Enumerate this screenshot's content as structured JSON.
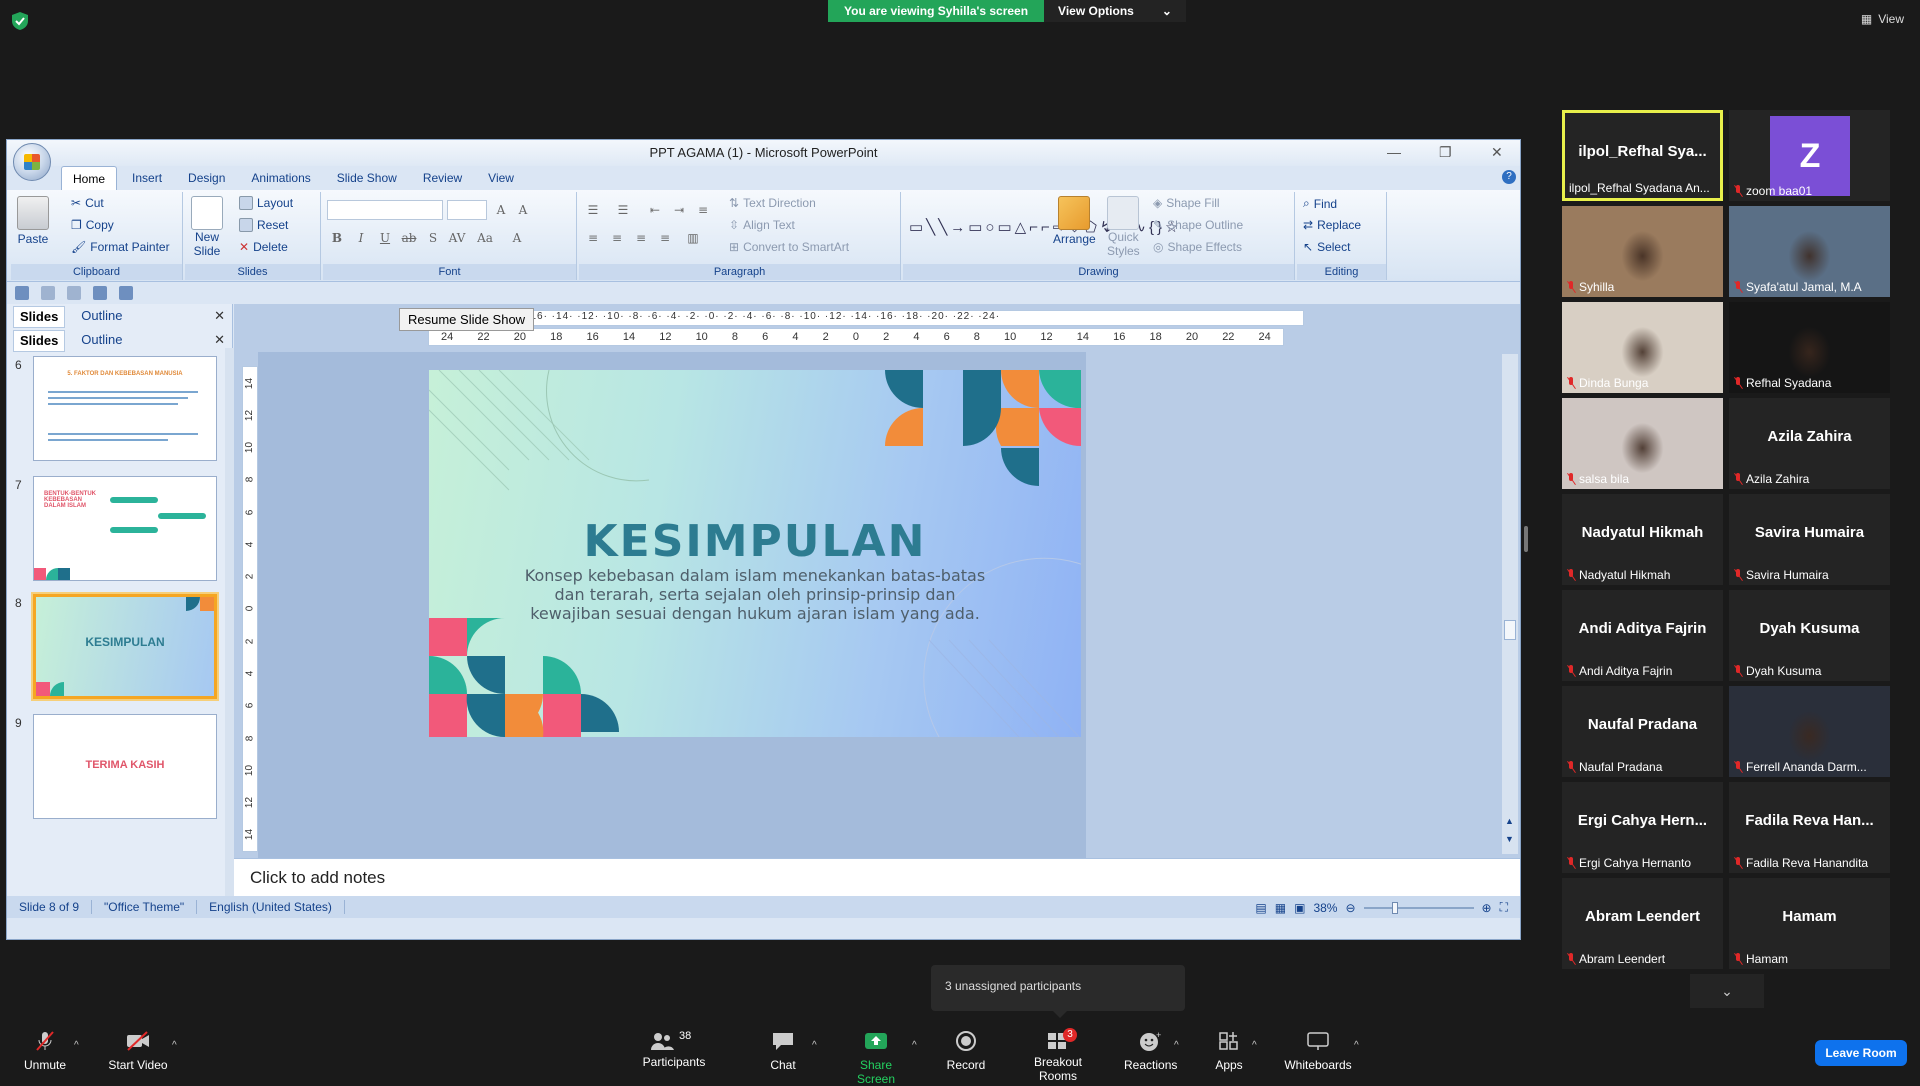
{
  "zoom_meeting": {
    "banner_text": "You are viewing Syhilla's screen",
    "view_options": "View Options",
    "view_button": "View",
    "unassigned_tooltip": "3 unassigned participants",
    "leave_button": "Leave Room"
  },
  "toolbar": {
    "unmute": "Unmute",
    "start_video": "Start Video",
    "participants": "Participants",
    "participants_count": "38",
    "chat": "Chat",
    "share_screen": "Share Screen",
    "record": "Record",
    "breakout_rooms": "Breakout Rooms",
    "breakout_badge": "3",
    "reactions": "Reactions",
    "apps": "Apps",
    "whiteboards": "Whiteboards"
  },
  "ppt": {
    "window_title": "PPT AGAMA (1) - Microsoft PowerPoint",
    "tabs": [
      "Home",
      "Insert",
      "Design",
      "Animations",
      "Slide Show",
      "Review",
      "View"
    ],
    "clipboard": {
      "paste": "Paste",
      "cut": "Cut",
      "copy": "Copy",
      "format_painter": "Format Painter",
      "label": "Clipboard"
    },
    "slides_group": {
      "new_slide_1": "New",
      "new_slide_2": "Slide",
      "layout": "Layout",
      "reset": "Reset",
      "delete": "Delete",
      "label": "Slides"
    },
    "font_group": {
      "label": "Font"
    },
    "paragraph_group": {
      "text_direction": "Text Direction",
      "align_text": "Align Text",
      "convert_smartart": "Convert to SmartArt",
      "label": "Paragraph"
    },
    "drawing_group": {
      "arrange": "Arrange",
      "quick_styles_1": "Quick",
      "quick_styles_2": "Styles",
      "shape_fill": "Shape Fill",
      "shape_outline": "Shape Outline",
      "shape_effects": "Shape Effects",
      "label": "Drawing"
    },
    "editing_group": {
      "find": "Find",
      "replace": "Replace",
      "select": "Select",
      "label": "Editing"
    },
    "panel_tabs": {
      "slides": "Slides",
      "outline": "Outline"
    },
    "thumbnails": [
      {
        "num": "6",
        "title": "5. FAKTOR DAN KEBEBASAN MANUSIA"
      },
      {
        "num": "7",
        "title": "BENTUK-BENTUK KEBEBASAN DALAM ISLAM"
      },
      {
        "num": "8",
        "title": "KESIMPULAN"
      },
      {
        "num": "9",
        "title": "TERIMA KASIH"
      }
    ],
    "resume_slideshow": "Resume Slide Show",
    "ruler_top": "·20· ·18· ·16· ·14· ·12· ·10· ·8· ·6· ·4· ·2· ·0· ·2· ·4· ·6· ·8· ·10· ·12· ·14· ·16· ·18· ·20· ·22· ·24·",
    "ruler_h": [
      "24",
      "22",
      "20",
      "18",
      "16",
      "14",
      "12",
      "10",
      "8",
      "6",
      "4",
      "2",
      "0",
      "2",
      "4",
      "6",
      "8",
      "10",
      "12",
      "14",
      "16",
      "18",
      "20",
      "22",
      "24"
    ],
    "ruler_v": [
      "14",
      "12",
      "10",
      "8",
      "6",
      "4",
      "2",
      "0",
      "2",
      "4",
      "6",
      "8",
      "10",
      "12",
      "14"
    ],
    "slide_title": "KESIMPULAN",
    "slide_body": "Konsep kebebasan dalam islam menekankan batas-batas dan terarah, serta sejalan oleh prinsip-prinsip dan kewajiban sesuai dengan hukum ajaran islam yang ada.",
    "notes_placeholder": "Click to add notes",
    "status": {
      "slide": "Slide 8 of 9",
      "theme": "\"Office Theme\"",
      "language": "English (United States)",
      "zoom": "38%"
    }
  },
  "participants": [
    {
      "name_display": "ilpol_Refhal Sya...",
      "label": "ilpol_Refhal Syadana An...",
      "type": "name",
      "active": true
    },
    {
      "name_display": "Z",
      "label": "zoom baa01",
      "type": "avatar",
      "avatar_color": "#7b4fd6"
    },
    {
      "label": "Syhilla",
      "type": "photo",
      "bg": "#9a7b5e"
    },
    {
      "label": "Syafa'atul Jamal, M.A",
      "type": "photo",
      "bg": "#5a6f86"
    },
    {
      "label": "Dinda Bunga",
      "type": "photo",
      "bg": "#d8cfc4"
    },
    {
      "label": "Refhal Syadana",
      "type": "photo",
      "bg": "#151515"
    },
    {
      "label": "salsa bila",
      "type": "photo",
      "bg": "#cfc6c2"
    },
    {
      "name_display": "Azila Zahira",
      "label": "Azila Zahira",
      "type": "name"
    },
    {
      "name_display": "Nadyatul Hikmah",
      "label": "Nadyatul Hikmah",
      "type": "name"
    },
    {
      "name_display": "Savira Humaira",
      "label": "Savira Humaira",
      "type": "name"
    },
    {
      "name_display": "Andi Aditya Fajrin",
      "label": "Andi Aditya Fajrin",
      "type": "name"
    },
    {
      "name_display": "Dyah Kusuma",
      "label": "Dyah Kusuma",
      "type": "name"
    },
    {
      "name_display": "Naufal Pradana",
      "label": "Naufal Pradana",
      "type": "name"
    },
    {
      "label": "Ferrell Ananda Darm...",
      "type": "photo",
      "bg": "#2a2f3a"
    },
    {
      "name_display": "Ergi Cahya Hern...",
      "label": "Ergi Cahya Hernanto",
      "type": "name"
    },
    {
      "name_display": "Fadila Reva Han...",
      "label": "Fadila Reva Hanandita",
      "type": "name"
    },
    {
      "name_display": "Abram Leendert",
      "label": "Abram Leendert",
      "type": "name"
    },
    {
      "name_display": "Hamam",
      "label": "Hamam",
      "type": "name"
    }
  ]
}
